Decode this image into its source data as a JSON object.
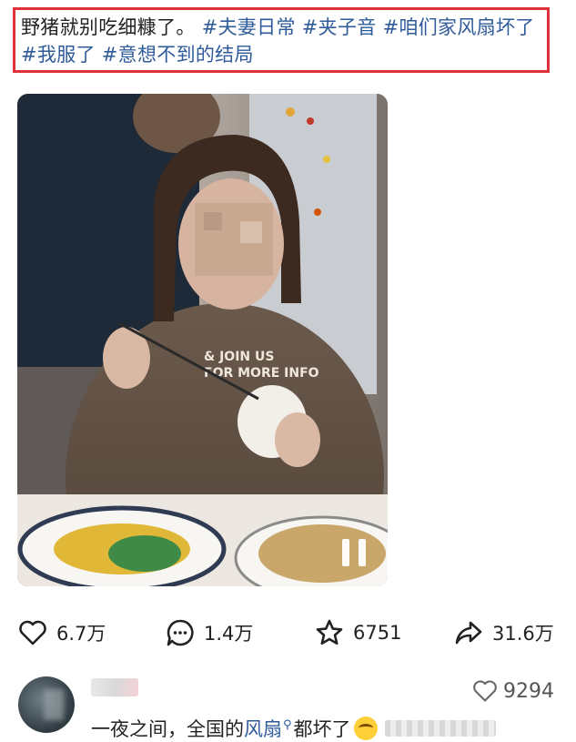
{
  "post": {
    "caption_text": "野猪就别吃细糠了。",
    "hashtags": [
      "#夫妻日常",
      "#夹子音",
      "#咱们家风扇坏了",
      "#我服了",
      "#意想不到的结局"
    ]
  },
  "video": {
    "shirt_text": "& JOIN US\nFOR MORE INFO",
    "state": "paused"
  },
  "actions": {
    "likes": "6.7万",
    "comments": "1.4万",
    "favorites": "6751",
    "shares": "31.6万"
  },
  "top_comment": {
    "likes": "9294",
    "text_before": "一夜之间，全国的",
    "link": "风扇",
    "text_after": "都坏了"
  },
  "colors": {
    "hashtag": "#2f5b9a",
    "highlight_border": "#e0303a"
  }
}
